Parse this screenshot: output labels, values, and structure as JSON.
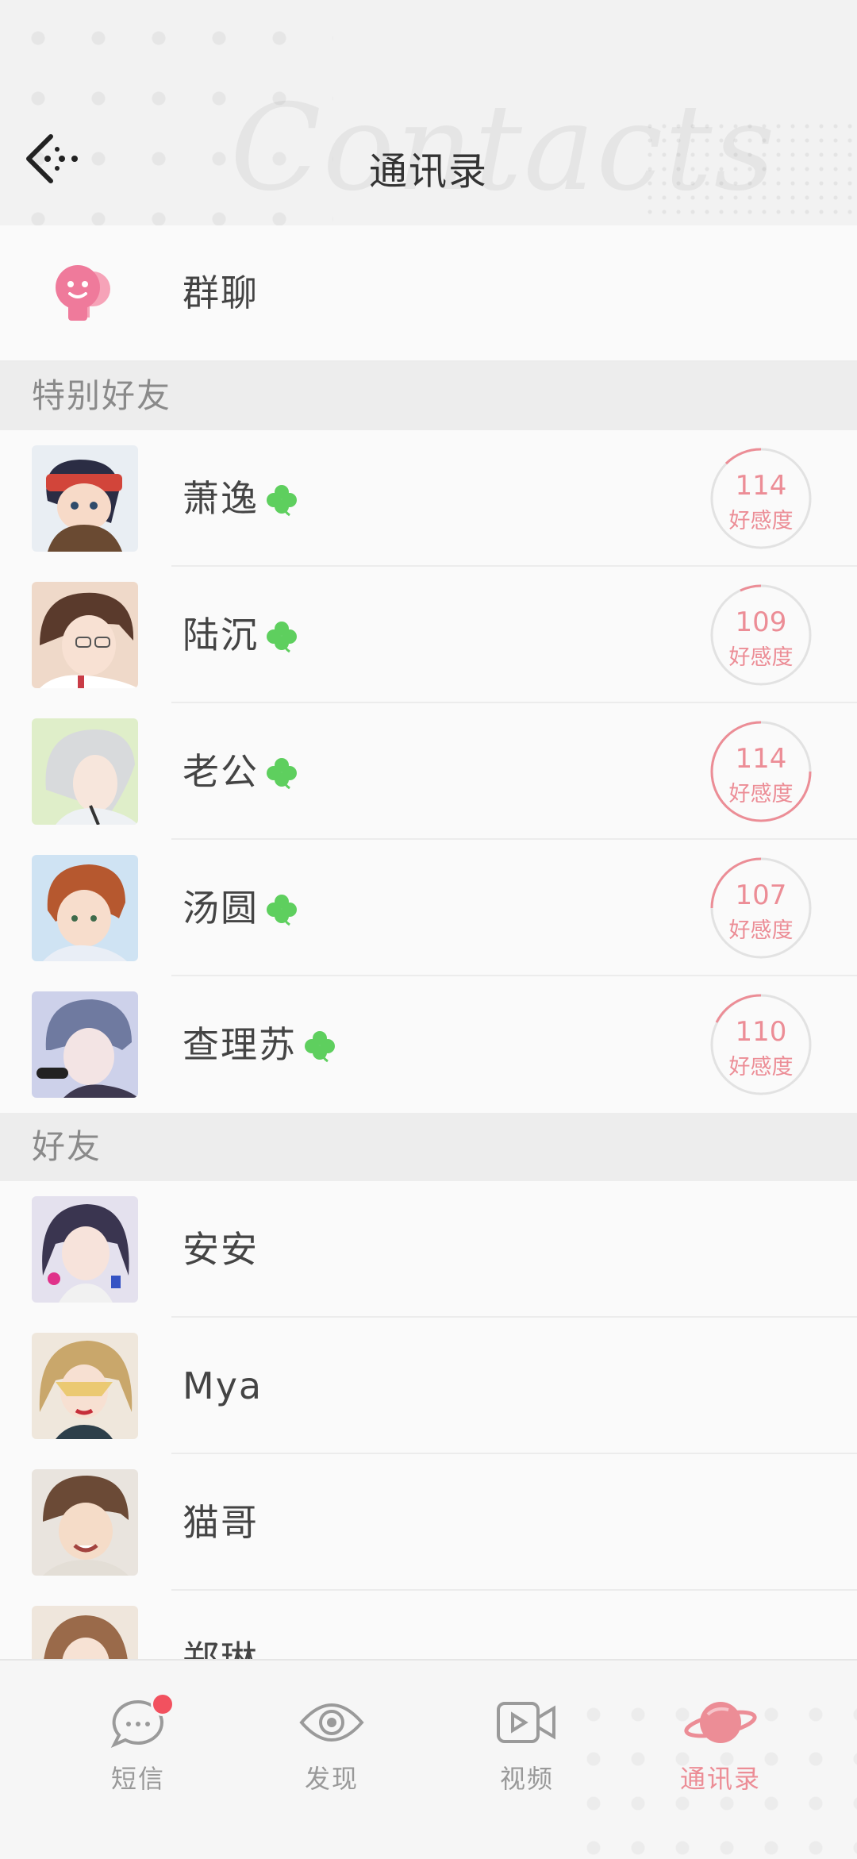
{
  "header": {
    "title": "通讯录",
    "bg_script": "Contacts"
  },
  "group_chat": {
    "label": "群聊"
  },
  "sections": {
    "special": "特别好友",
    "friends": "好友"
  },
  "special_friends": [
    {
      "name": "萧逸",
      "affinity": "114",
      "affinity_label": "好感度"
    },
    {
      "name": "陆沉",
      "affinity": "109",
      "affinity_label": "好感度"
    },
    {
      "name": "老公",
      "affinity": "114",
      "affinity_label": "好感度"
    },
    {
      "name": "汤圆",
      "affinity": "107",
      "affinity_label": "好感度"
    },
    {
      "name": "查理苏",
      "affinity": "110",
      "affinity_label": "好感度"
    }
  ],
  "friends": [
    {
      "name": "安安"
    },
    {
      "name": "Mya"
    },
    {
      "name": "猫哥"
    },
    {
      "name": "郑琳"
    }
  ],
  "nav": [
    {
      "label": "短信",
      "icon": "chat-bubble-icon",
      "has_badge": true
    },
    {
      "label": "发现",
      "icon": "eye-icon"
    },
    {
      "label": "视频",
      "icon": "video-camera-icon"
    },
    {
      "label": "通讯录",
      "icon": "planet-icon",
      "active": true
    }
  ],
  "colors": {
    "accent": "#ec8d96",
    "clover": "#5ecf5e",
    "badge": "#f2515f"
  }
}
